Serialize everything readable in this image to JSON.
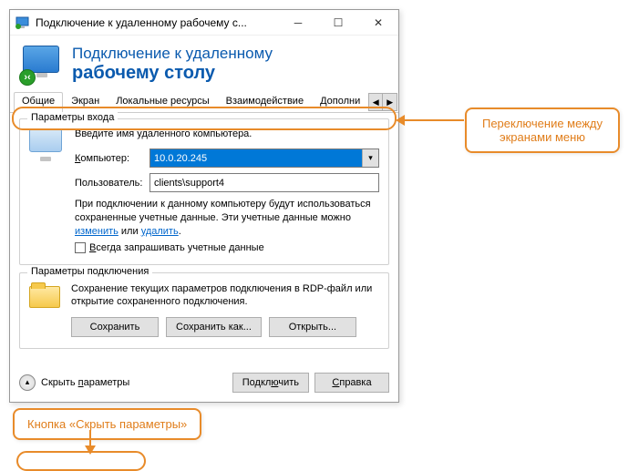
{
  "window": {
    "title": "Подключение к удаленному рабочему с..."
  },
  "header": {
    "line1": "Подключение к удаленному",
    "line2": "рабочему столу"
  },
  "tabs": [
    "Общие",
    "Экран",
    "Локальные ресурсы",
    "Взаимодействие",
    "Дополни"
  ],
  "login": {
    "group_title": "Параметры входа",
    "instruction": "Введите имя удаленного компьютера.",
    "computer_label": "Компьютер:",
    "computer_value": "10.0.20.245",
    "user_label": "Пользователь:",
    "user_value": "clients\\support4",
    "note_pre": "При подключении к данному компьютеру будут использоваться сохраненные учетные данные.  Эти учетные данные можно ",
    "note_link1": "изменить",
    "note_mid": " или ",
    "note_link2": "удалить",
    "note_post": ".",
    "always_ask": "Всегда запрашивать учетные данные"
  },
  "conn": {
    "group_title": "Параметры подключения",
    "text": "Сохранение текущих параметров подключения в RDP-файл или открытие сохраненного подключения.",
    "save": "Сохранить",
    "save_as": "Сохранить как...",
    "open": "Открыть..."
  },
  "footer": {
    "hide": "Скрыть параметры",
    "connect": "Подключить",
    "help": "Справка"
  },
  "callouts": {
    "tabs": "Переключение между экранами меню",
    "hide": "Кнопка «Скрыть параметры»"
  }
}
